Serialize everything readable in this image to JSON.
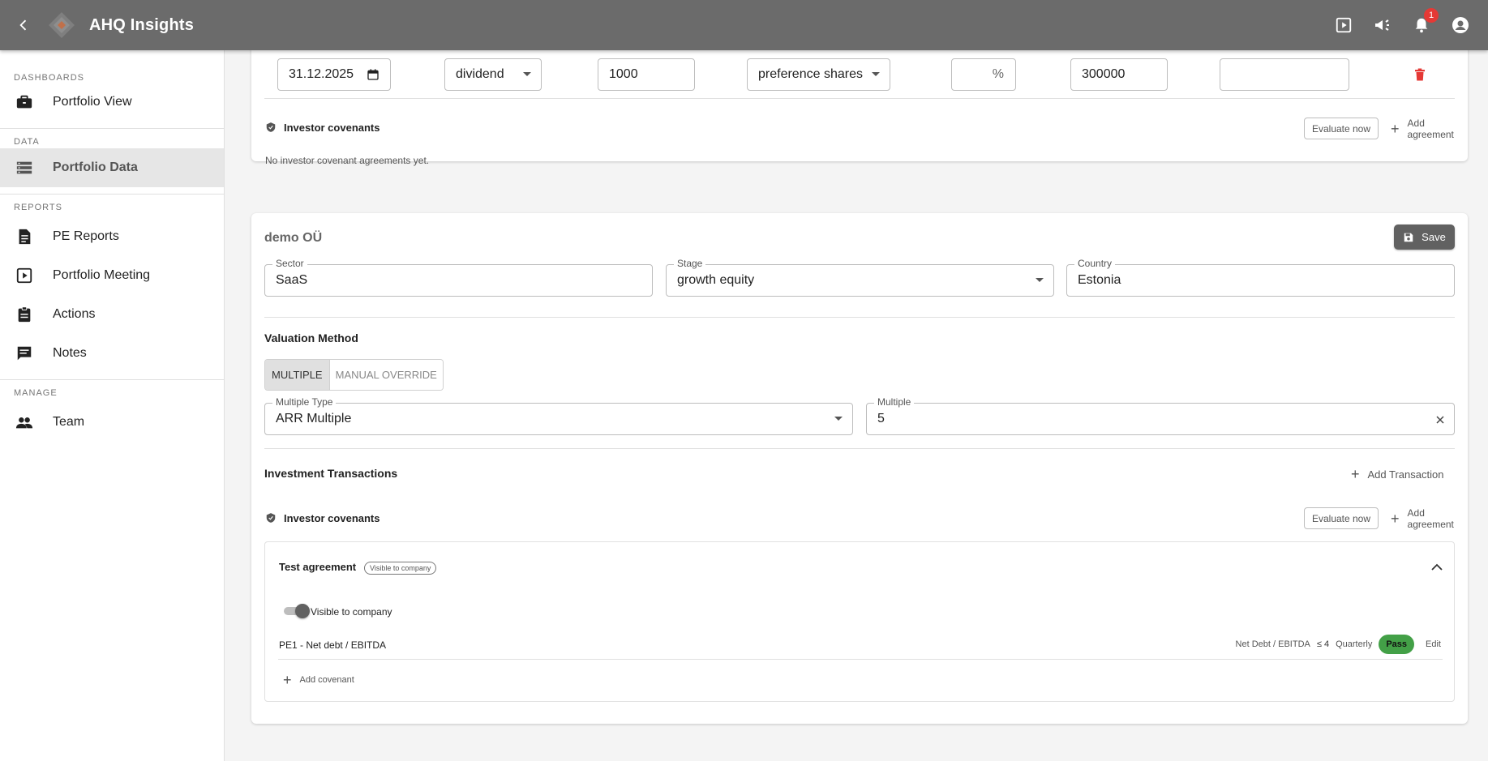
{
  "app": {
    "title": "AHQ Insights",
    "notification_count": "1"
  },
  "sidebar": {
    "sections": {
      "dashboards": "DASHBOARDS",
      "data": "DATA",
      "reports": "REPORTS",
      "manage": "MANAGE"
    },
    "items": {
      "portfolio_view": "Portfolio View",
      "portfolio_data": "Portfolio Data",
      "pe_reports": "PE Reports",
      "portfolio_meeting": "Portfolio Meeting",
      "actions": "Actions",
      "notes": "Notes",
      "team": "Team"
    }
  },
  "top_card": {
    "transaction_row": {
      "date": "31.12.2025",
      "type": "dividend",
      "amount": "1000",
      "share_class": "preference shares",
      "percent_value": "",
      "percent_unit": "%",
      "valuation": "300000",
      "extra": ""
    },
    "covenants_title": "Investor covenants",
    "evaluate_label": "Evaluate now",
    "add_agreement_label": "Add agreement",
    "empty_text": "No investor covenant agreements yet."
  },
  "company": {
    "name": "demo OÜ",
    "save_label": "Save",
    "sector_label": "Sector",
    "sector_value": "SaaS",
    "stage_label": "Stage",
    "stage_value": "growth equity",
    "country_label": "Country",
    "country_value": "Estonia",
    "valuation_method_title": "Valuation Method",
    "method_multiple": "MULTIPLE",
    "method_manual": "MANUAL OVERRIDE",
    "multiple_type_label": "Multiple Type",
    "multiple_type_value": "ARR Multiple",
    "multiple_label": "Multiple",
    "multiple_value": "5",
    "transactions_title": "Investment Transactions",
    "add_transaction_label": "Add Transaction",
    "covenants_title": "Investor covenants",
    "evaluate_label": "Evaluate now",
    "add_agreement_label": "Add agreement",
    "agreement": {
      "name": "Test agreement",
      "badge": "Visible to company",
      "toggle_label": "Visible to company",
      "covenant_name": "PE1 - Net debt / EBITDA",
      "metric": "Net Debt / EBITDA",
      "threshold": "≤ 4",
      "frequency": "Quarterly",
      "status": "Pass",
      "edit_label": "Edit",
      "add_covenant_label": "Add covenant"
    }
  },
  "colors": {
    "appbar": "#6b6b6b",
    "pass": "#43a047",
    "delete": "#e53935",
    "badge": "#e53935"
  }
}
